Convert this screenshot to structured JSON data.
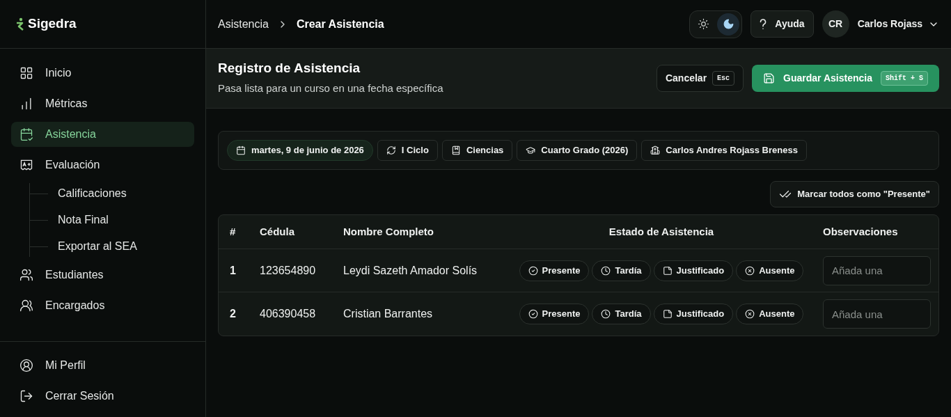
{
  "brand": {
    "name": "Sigedra"
  },
  "sidebar": {
    "items": [
      {
        "label": "Inicio",
        "selected": false
      },
      {
        "label": "Métricas",
        "selected": false
      },
      {
        "label": "Asistencia",
        "selected": true
      },
      {
        "label": "Evaluación",
        "selected": false,
        "children": [
          {
            "label": "Calificaciones",
            "selected": false
          },
          {
            "label": "Nota Final",
            "selected": false
          },
          {
            "label": "Exportar al SEA",
            "selected": false
          }
        ]
      },
      {
        "label": "Estudiantes",
        "selected": false
      },
      {
        "label": "Encargados",
        "selected": false
      }
    ],
    "footer": [
      {
        "label": "Mi Perfil"
      },
      {
        "label": "Cerrar Sesión"
      }
    ]
  },
  "breadcrumb": [
    "Asistencia",
    "Crear Asistencia"
  ],
  "theme_toggle": [
    {
      "selected": false
    },
    {
      "selected": true
    }
  ],
  "help_button": "Ayuda",
  "user": {
    "initials": "CR",
    "name": "Carlos Rojass"
  },
  "page": {
    "title": "Registro de Asistencia",
    "subtitle": "Pasa lista para un curso en una fecha específica",
    "cancel": {
      "label": "Cancelar",
      "shortcut": "Esc"
    },
    "save": {
      "label": "Guardar Asistencia",
      "shortcut": "Shift + S"
    }
  },
  "filters": [
    {
      "label": "martes, 9 de junio de 2026",
      "selected": true
    },
    {
      "label": "I Ciclo",
      "selected": false
    },
    {
      "label": "Ciencias",
      "selected": false
    },
    {
      "label": "Cuarto Grado (2026)",
      "selected": false
    },
    {
      "label": "Carlos Andres Rojass Breness",
      "selected": false
    }
  ],
  "mark_all_button": "Marcar todos como \"Presente\"",
  "table": {
    "columns": [
      "#",
      "Cédula",
      "Nombre Completo",
      "Estado de Asistencia",
      "Observaciones"
    ],
    "rows": [
      {
        "number": "1",
        "id": "123654890",
        "name": "Leydi Sazeth Amador Solís",
        "statuses": [
          {
            "label": "Presente",
            "kind": "present",
            "selected": false
          },
          {
            "label": "Tardía",
            "kind": "late",
            "selected": false
          },
          {
            "label": "Justificado",
            "kind": "justified",
            "selected": false
          },
          {
            "label": "Ausente",
            "kind": "absent",
            "selected": false
          }
        ],
        "observation_placeholder": "Añada una"
      },
      {
        "number": "2",
        "id": "406390458",
        "name": "Cristian Barrantes",
        "statuses": [
          {
            "label": "Presente",
            "kind": "present",
            "selected": false
          },
          {
            "label": "Tardía",
            "kind": "late",
            "selected": false
          },
          {
            "label": "Justificado",
            "kind": "justified",
            "selected": false
          },
          {
            "label": "Ausente",
            "kind": "absent",
            "selected": false
          }
        ],
        "observation_placeholder": "Añada una"
      }
    ]
  }
}
